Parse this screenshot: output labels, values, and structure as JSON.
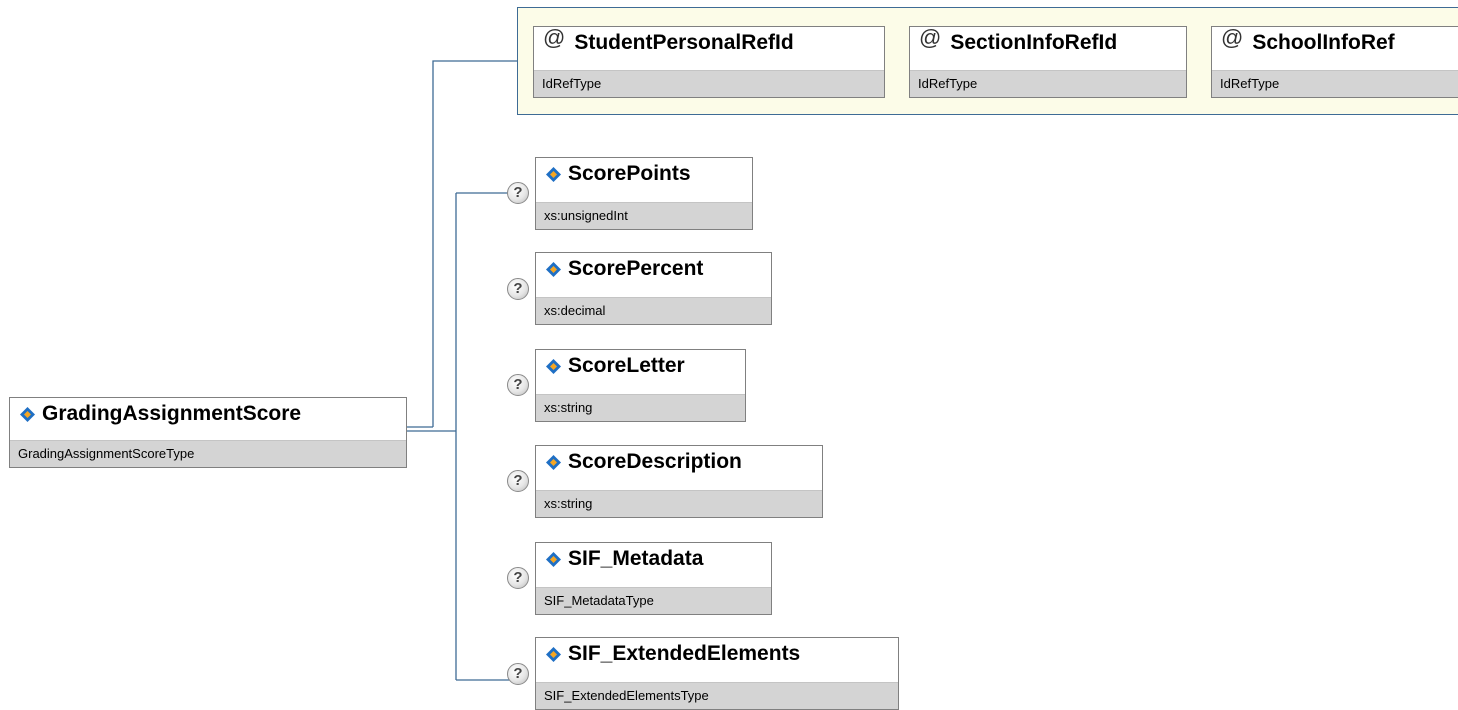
{
  "root": {
    "name": "GradingAssignmentScore",
    "type": "GradingAssignmentScoreType"
  },
  "attributes": [
    {
      "name": "StudentPersonalRefId",
      "type": "IdRefType"
    },
    {
      "name": "SectionInfoRefId",
      "type": "IdRefType"
    },
    {
      "name": "SchoolInfoRef",
      "type": "IdRefType"
    }
  ],
  "children": [
    {
      "name": "ScorePoints",
      "type": "xs:unsignedInt"
    },
    {
      "name": "ScorePercent",
      "type": "xs:decimal"
    },
    {
      "name": "ScoreLetter",
      "type": "xs:string"
    },
    {
      "name": "ScoreDescription",
      "type": "xs:string"
    },
    {
      "name": "SIF_Metadata",
      "type": "SIF_MetadataType"
    },
    {
      "name": "SIF_ExtendedElements",
      "type": "SIF_ExtendedElementsType"
    }
  ],
  "optional_marker": "?",
  "attribute_marker": "@",
  "colors": {
    "connector": "#3e6b95",
    "group_border": "#3e6b95",
    "group_fill": "#fcfce8",
    "type_band": "#d4d4d4",
    "element_icon_blue": "#1f6fc4",
    "element_icon_orange": "#f5a623"
  }
}
